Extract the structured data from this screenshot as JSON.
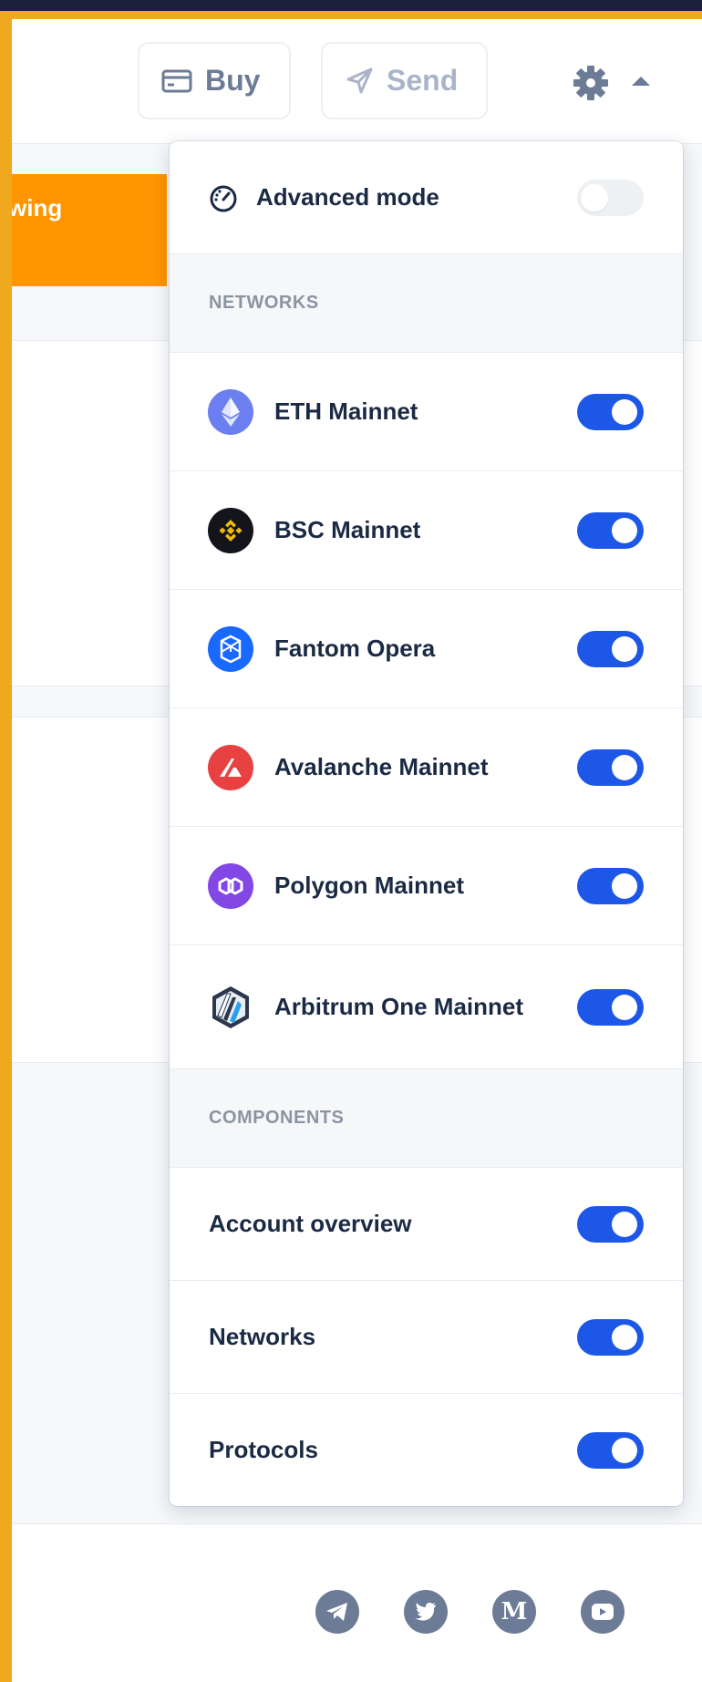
{
  "header": {
    "buy_label": "Buy",
    "send_label": "Send"
  },
  "background": {
    "banner_fragment": "wing"
  },
  "settings": {
    "advanced_mode": {
      "label": "Advanced mode",
      "enabled": false
    },
    "networks_heading": "NETWORKS",
    "networks": [
      {
        "label": "ETH Mainnet",
        "icon": "ethereum-icon",
        "color": "#6b7ff0",
        "enabled": true
      },
      {
        "label": "BSC Mainnet",
        "icon": "binance-icon",
        "color": "#14151a",
        "enabled": true
      },
      {
        "label": "Fantom Opera",
        "icon": "fantom-icon",
        "color": "#1969ff",
        "enabled": true
      },
      {
        "label": "Avalanche Mainnet",
        "icon": "avalanche-icon",
        "color": "#e84142",
        "enabled": true
      },
      {
        "label": "Polygon Mainnet",
        "icon": "polygon-icon",
        "color": "#8247e5",
        "enabled": true
      },
      {
        "label": "Arbitrum One Mainnet",
        "icon": "arbitrum-icon",
        "color": "#2d374b",
        "enabled": true
      }
    ],
    "components_heading": "COMPONENTS",
    "components": [
      {
        "label": "Account overview",
        "enabled": true
      },
      {
        "label": "Networks",
        "enabled": true
      },
      {
        "label": "Protocols",
        "enabled": true
      }
    ]
  },
  "footer": {
    "social": [
      "telegram-icon",
      "twitter-icon",
      "medium-icon",
      "youtube-icon"
    ]
  },
  "colors": {
    "accent": "#1c57e8",
    "frame": "#f0a91e",
    "banner": "#ff9500"
  }
}
